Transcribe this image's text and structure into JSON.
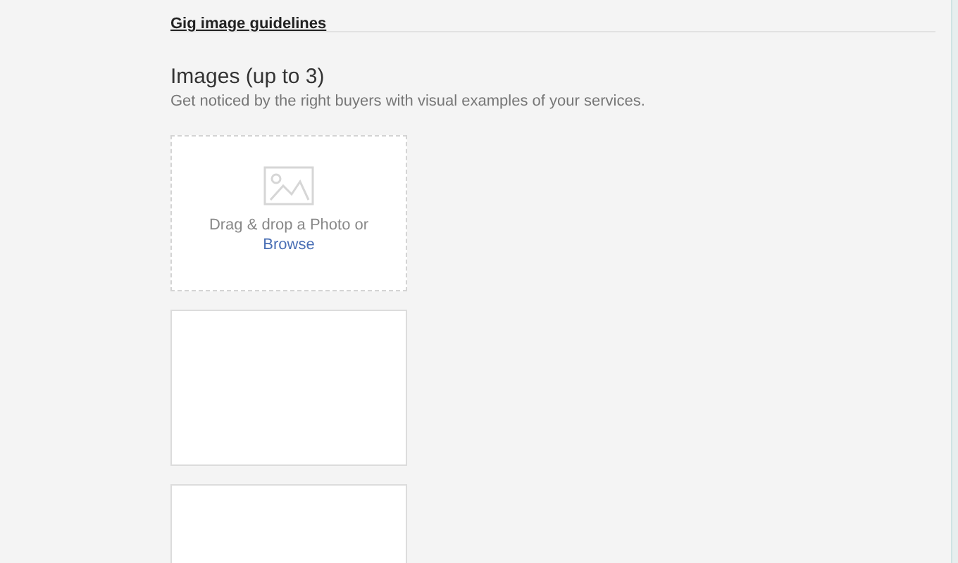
{
  "guidelines_link": "Gig image guidelines",
  "section": {
    "title": "Images (up to 3)",
    "subtitle": "Get noticed by the right buyers with visual examples of your services."
  },
  "slots": [
    {
      "kind": "dropzone",
      "prompt": "Drag & drop a Photo or",
      "link": "Browse"
    },
    {
      "kind": "empty"
    },
    {
      "kind": "empty"
    }
  ]
}
